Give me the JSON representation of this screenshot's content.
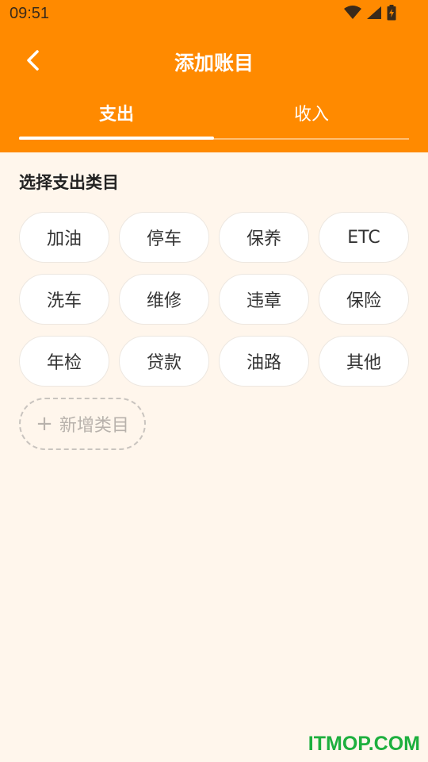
{
  "status_bar": {
    "time": "09:51",
    "icons": [
      "wifi-icon",
      "signal-icon",
      "battery-charging-icon"
    ]
  },
  "header": {
    "title": "添加账目",
    "back_icon": "back-chevron-icon"
  },
  "tabs": [
    {
      "label": "支出",
      "active": true
    },
    {
      "label": "收入",
      "active": false
    }
  ],
  "section": {
    "title": "选择支出类目"
  },
  "categories": [
    "加油",
    "停车",
    "保养",
    "ETC",
    "洗车",
    "维修",
    "违章",
    "保险",
    "年检",
    "贷款",
    "油路",
    "其他"
  ],
  "add_category": {
    "icon": "plus-icon",
    "label": "新增类目"
  },
  "watermark": "ITMOP.COM",
  "colors": {
    "accent": "#FF8A00",
    "background": "#FFF6EC",
    "chip_background": "#FFFFFF",
    "watermark": "#1DAF3E"
  }
}
